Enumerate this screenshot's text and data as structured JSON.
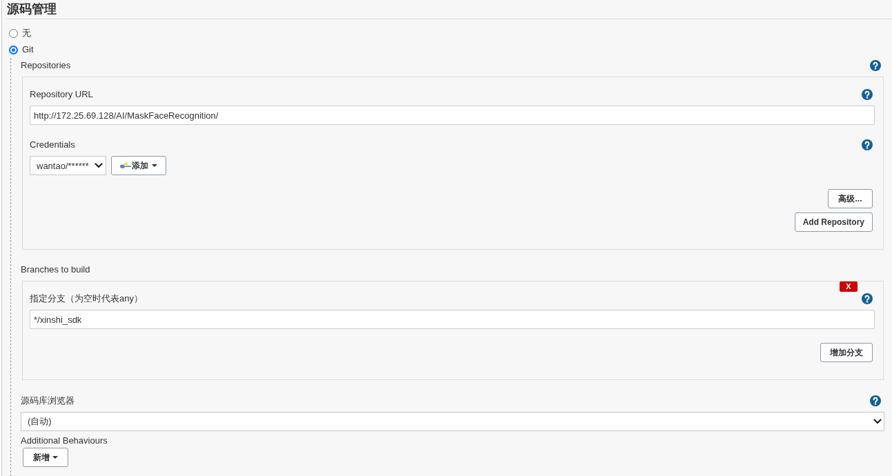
{
  "section": {
    "title": "源码管理"
  },
  "scm_options": [
    {
      "label": "无",
      "selected": false
    },
    {
      "label": "Git",
      "selected": true
    }
  ],
  "repositories": {
    "label": "Repositories",
    "items": [
      {
        "url_label": "Repository URL",
        "url": "http://172.25.69.128/AI/MaskFaceRecognition/",
        "credentials_label": "Credentials",
        "credentials": "wantao/******",
        "add_credentials_button": "添加",
        "advanced_button": "高级..."
      }
    ],
    "add_button": "Add Repository"
  },
  "branches": {
    "label": "Branches to build",
    "items": [
      {
        "label": "指定分支（为空时代表any）",
        "value": "*/xinshi_sdk",
        "delete_button": "X"
      }
    ],
    "add_button": "增加分支"
  },
  "repository_browser": {
    "label": "源码库浏览器",
    "value": "(自动)"
  },
  "additional_behaviours": {
    "label": "Additional Behaviours",
    "add_button": "新增"
  }
}
